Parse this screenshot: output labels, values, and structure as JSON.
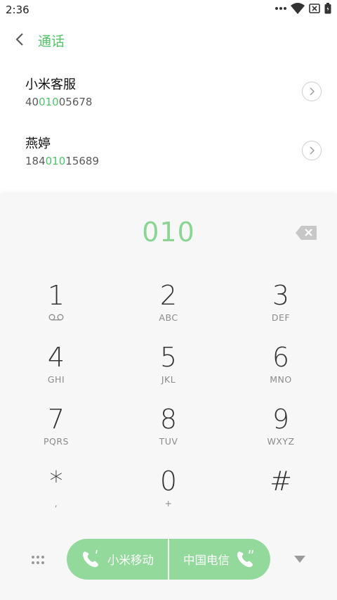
{
  "status": {
    "time": "2:36"
  },
  "header": {
    "title": "通话"
  },
  "contacts": [
    {
      "name": "小米客服",
      "number_pre": "40",
      "number_hl": "010",
      "number_post": "05678"
    },
    {
      "name": "燕婷",
      "number_pre": "184",
      "number_hl": "010",
      "number_post": "15689"
    }
  ],
  "dialer": {
    "input": "010"
  },
  "keys": [
    {
      "digit": "1",
      "letters": "voicemail-icon"
    },
    {
      "digit": "2",
      "letters": "ABC"
    },
    {
      "digit": "3",
      "letters": "DEF"
    },
    {
      "digit": "4",
      "letters": "GHI"
    },
    {
      "digit": "5",
      "letters": "JKL"
    },
    {
      "digit": "6",
      "letters": "MNO"
    },
    {
      "digit": "7",
      "letters": "PQRS"
    },
    {
      "digit": "8",
      "letters": "TUV"
    },
    {
      "digit": "9",
      "letters": "WXYZ"
    },
    {
      "digit": "*",
      "letters": ","
    },
    {
      "digit": "0",
      "letters": "+"
    },
    {
      "digit": "#",
      "letters": ""
    }
  ],
  "call": {
    "sim1": "小米移动",
    "sim2": "中国电信"
  },
  "colors": {
    "accent": "#4ec567",
    "call_button": "#92d99b"
  }
}
